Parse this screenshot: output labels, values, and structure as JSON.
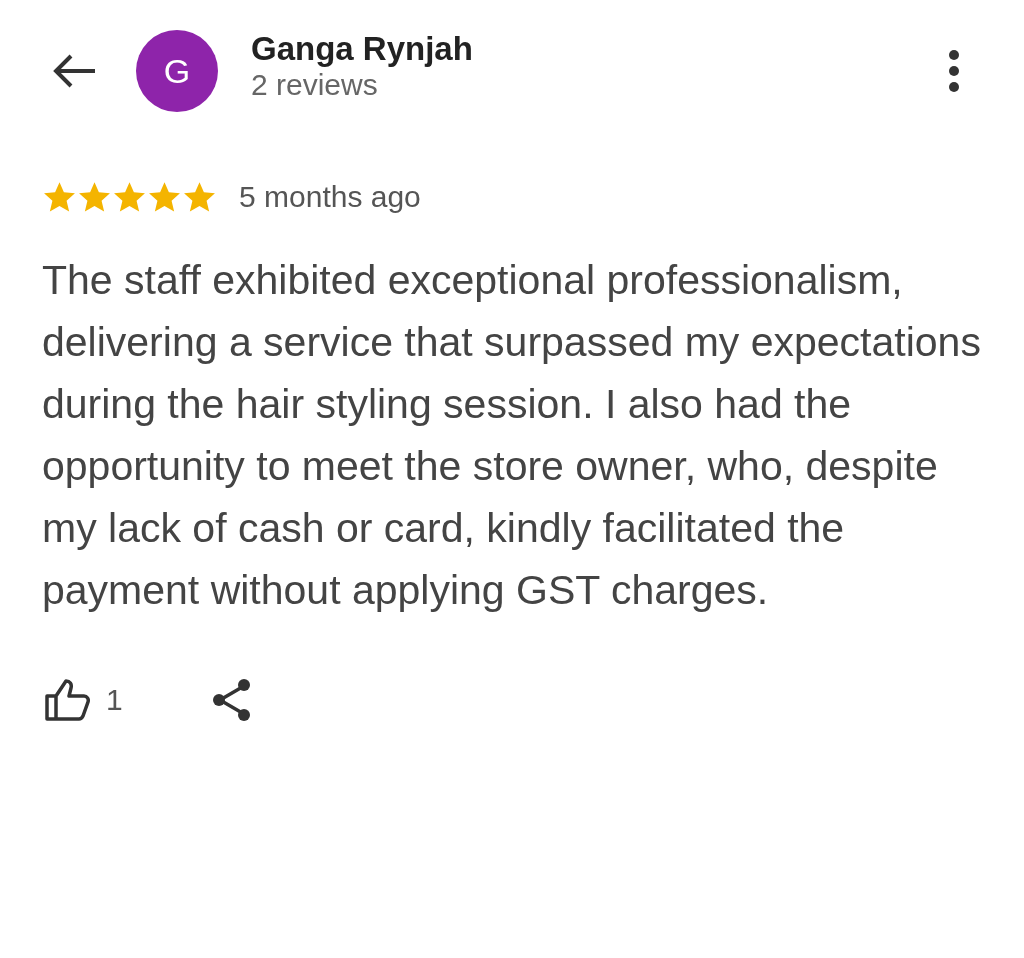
{
  "reviewer": {
    "initial": "G",
    "name": "Ganga Rynjah",
    "review_count": "2 reviews"
  },
  "review": {
    "stars": 5,
    "time": "5 months ago",
    "text": "The staff exhibited exceptional professionalism, delivering a service that surpassed my expectations during the hair styling session. I also had the opportunity to meet the store owner, who, despite my lack of cash or card, kindly facilitated the payment without applying GST charges."
  },
  "actions": {
    "like_count": "1"
  }
}
